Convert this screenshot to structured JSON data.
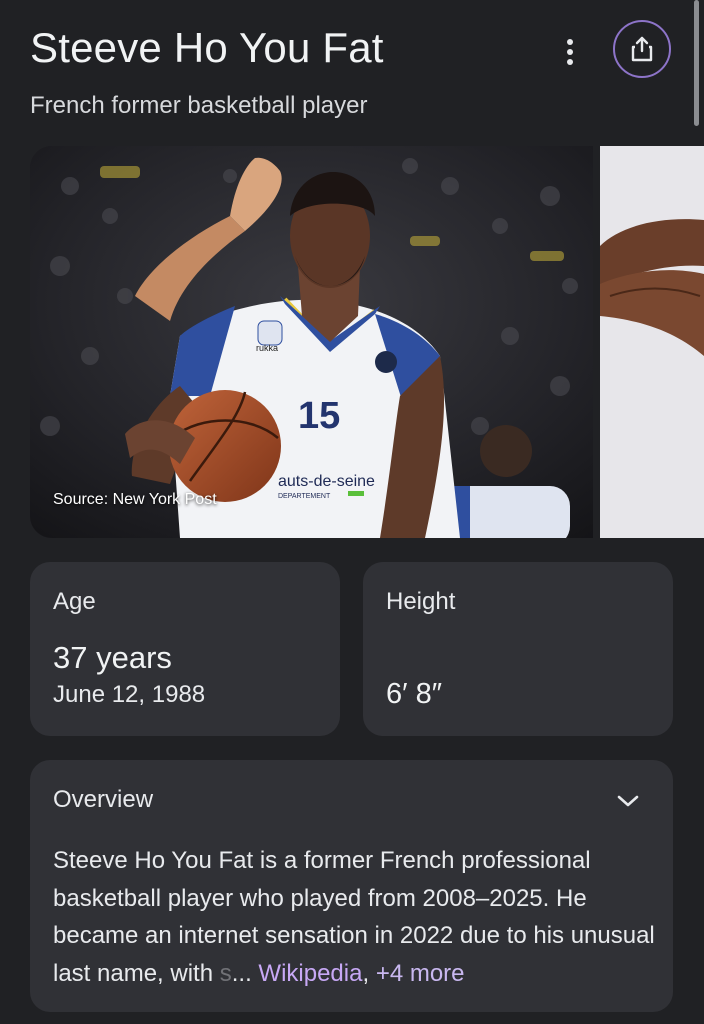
{
  "header": {
    "title": "Steeve Ho You Fat",
    "subtitle": "French former basketball player"
  },
  "icons": {
    "more": "vertical-dots-icon",
    "share": "share-icon",
    "expand": "chevron-down-icon"
  },
  "images": {
    "main_source": "Source: New York Post",
    "jersey_number": "15",
    "jersey_brand": "rukka",
    "jersey_sponsor": "auts-de-seine",
    "jersey_sponsor_sub": "DEPARTEMENT"
  },
  "facts": {
    "age": {
      "label": "Age",
      "value": "37 years",
      "sub": "June 12, 1988"
    },
    "height": {
      "label": "Height",
      "value": "6′ 8″"
    }
  },
  "overview": {
    "title": "Overview",
    "text": "Steeve Ho You Fat is a former French professional basketball player who played from 2008–2025. He became an internet sensation in 2022 due to his unusual last name, with ",
    "faded": "s",
    "ellipsis": "...",
    "source_link": "Wikipedia",
    "comma": ",",
    "more_link": "+4 more"
  },
  "colors": {
    "background": "#202124",
    "card": "#303136",
    "accent_purple": "#8d74c9",
    "link": "#c7a8f5",
    "jersey_blue": "#2f4f9f",
    "jersey_yellow": "#e9c93f"
  }
}
